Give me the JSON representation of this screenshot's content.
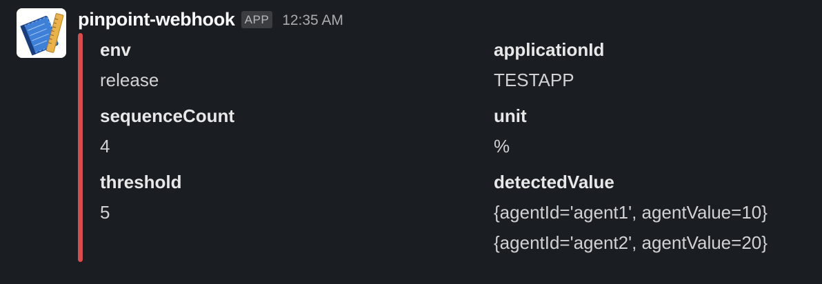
{
  "message": {
    "sender": "pinpoint-webhook",
    "badge": "APP",
    "timestamp": "12:35 AM",
    "avatar_icon": "blueprint-ruler-icon",
    "attachment_color": "#e0484a"
  },
  "fields": {
    "env": {
      "name": "env",
      "value": "release"
    },
    "applicationId": {
      "name": "applicationId",
      "value": "TESTAPP"
    },
    "sequenceCount": {
      "name": "sequenceCount",
      "value": "4"
    },
    "unit": {
      "name": "unit",
      "value": "%"
    },
    "threshold": {
      "name": "threshold",
      "value": "5"
    },
    "detectedValue": {
      "name": "detectedValue",
      "values": [
        "{agentId='agent1', agentValue=10}",
        "{agentId='agent2', agentValue=20}"
      ]
    }
  }
}
